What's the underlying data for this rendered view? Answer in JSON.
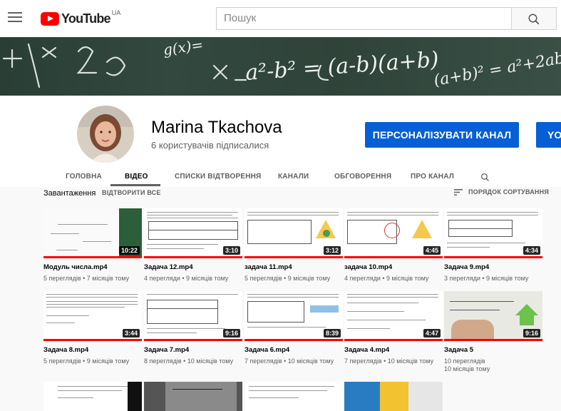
{
  "topbar": {
    "logo_text": "YouTube",
    "logo_region": "UA",
    "search_placeholder": "Пошук"
  },
  "channel": {
    "name": "Marina Tkachova",
    "subscribers": "6 користувачів підписалися",
    "customize_button": "ПЕРСОНАЛІЗУВАТИ КАНАЛ",
    "second_button": "YOU"
  },
  "tabs": [
    {
      "label": "ГОЛОВНА"
    },
    {
      "label": "ВІДЕО"
    },
    {
      "label": "СПИСКИ ВІДТВОРЕННЯ"
    },
    {
      "label": "КАНАЛИ"
    },
    {
      "label": "ОБГОВОРЕННЯ"
    },
    {
      "label": "ПРО КАНАЛ"
    }
  ],
  "section": {
    "title": "Завантаження",
    "play_all": "ВІДТВОРИТИ ВСЕ",
    "sort": "ПОРЯДОК СОРТУВАННЯ"
  },
  "videos": [
    {
      "title": "Модуль числа.mp4",
      "duration": "10:22",
      "views": "5 переглядів",
      "age": "7 місяців тому"
    },
    {
      "title": "Задача 12.mp4",
      "duration": "3:10",
      "views": "4 перегляди",
      "age": "9 місяців тому"
    },
    {
      "title": "задача 11.mp4",
      "duration": "3:12",
      "views": "5 переглядів",
      "age": "9 місяців тому"
    },
    {
      "title": "задача 10.mp4",
      "duration": "4:45",
      "views": "4 перегляди",
      "age": "9 місяців тому"
    },
    {
      "title": "Задача 9.mp4",
      "duration": "4:34",
      "views": "3 перегляди",
      "age": "9 місяців тому"
    },
    {
      "title": "Задача 8.mp4",
      "duration": "3:44",
      "views": "5 переглядів",
      "age": "9 місяців тому"
    },
    {
      "title": "Задача 7.mp4",
      "duration": "9:16",
      "views": "8 переглядів",
      "age": "10 місяців тому"
    },
    {
      "title": "Задача 6.mp4",
      "duration": "8:39",
      "views": "7 переглядів",
      "age": "10 місяців тому"
    },
    {
      "title": "Задача 4.mp4",
      "duration": "4:47",
      "views": "7 переглядів",
      "age": "10 місяців тому"
    },
    {
      "title": "Задача 5",
      "duration": "9:16",
      "views": "10 переглядів",
      "age": "10 місяців тому"
    }
  ],
  "banner_text": [
    "a²-b² = (a-b)(a+b)",
    "(a+b)² = a²+2ab",
    "g(x)="
  ],
  "colors": {
    "accent": "#065fd4",
    "brand": "#ff0000"
  }
}
